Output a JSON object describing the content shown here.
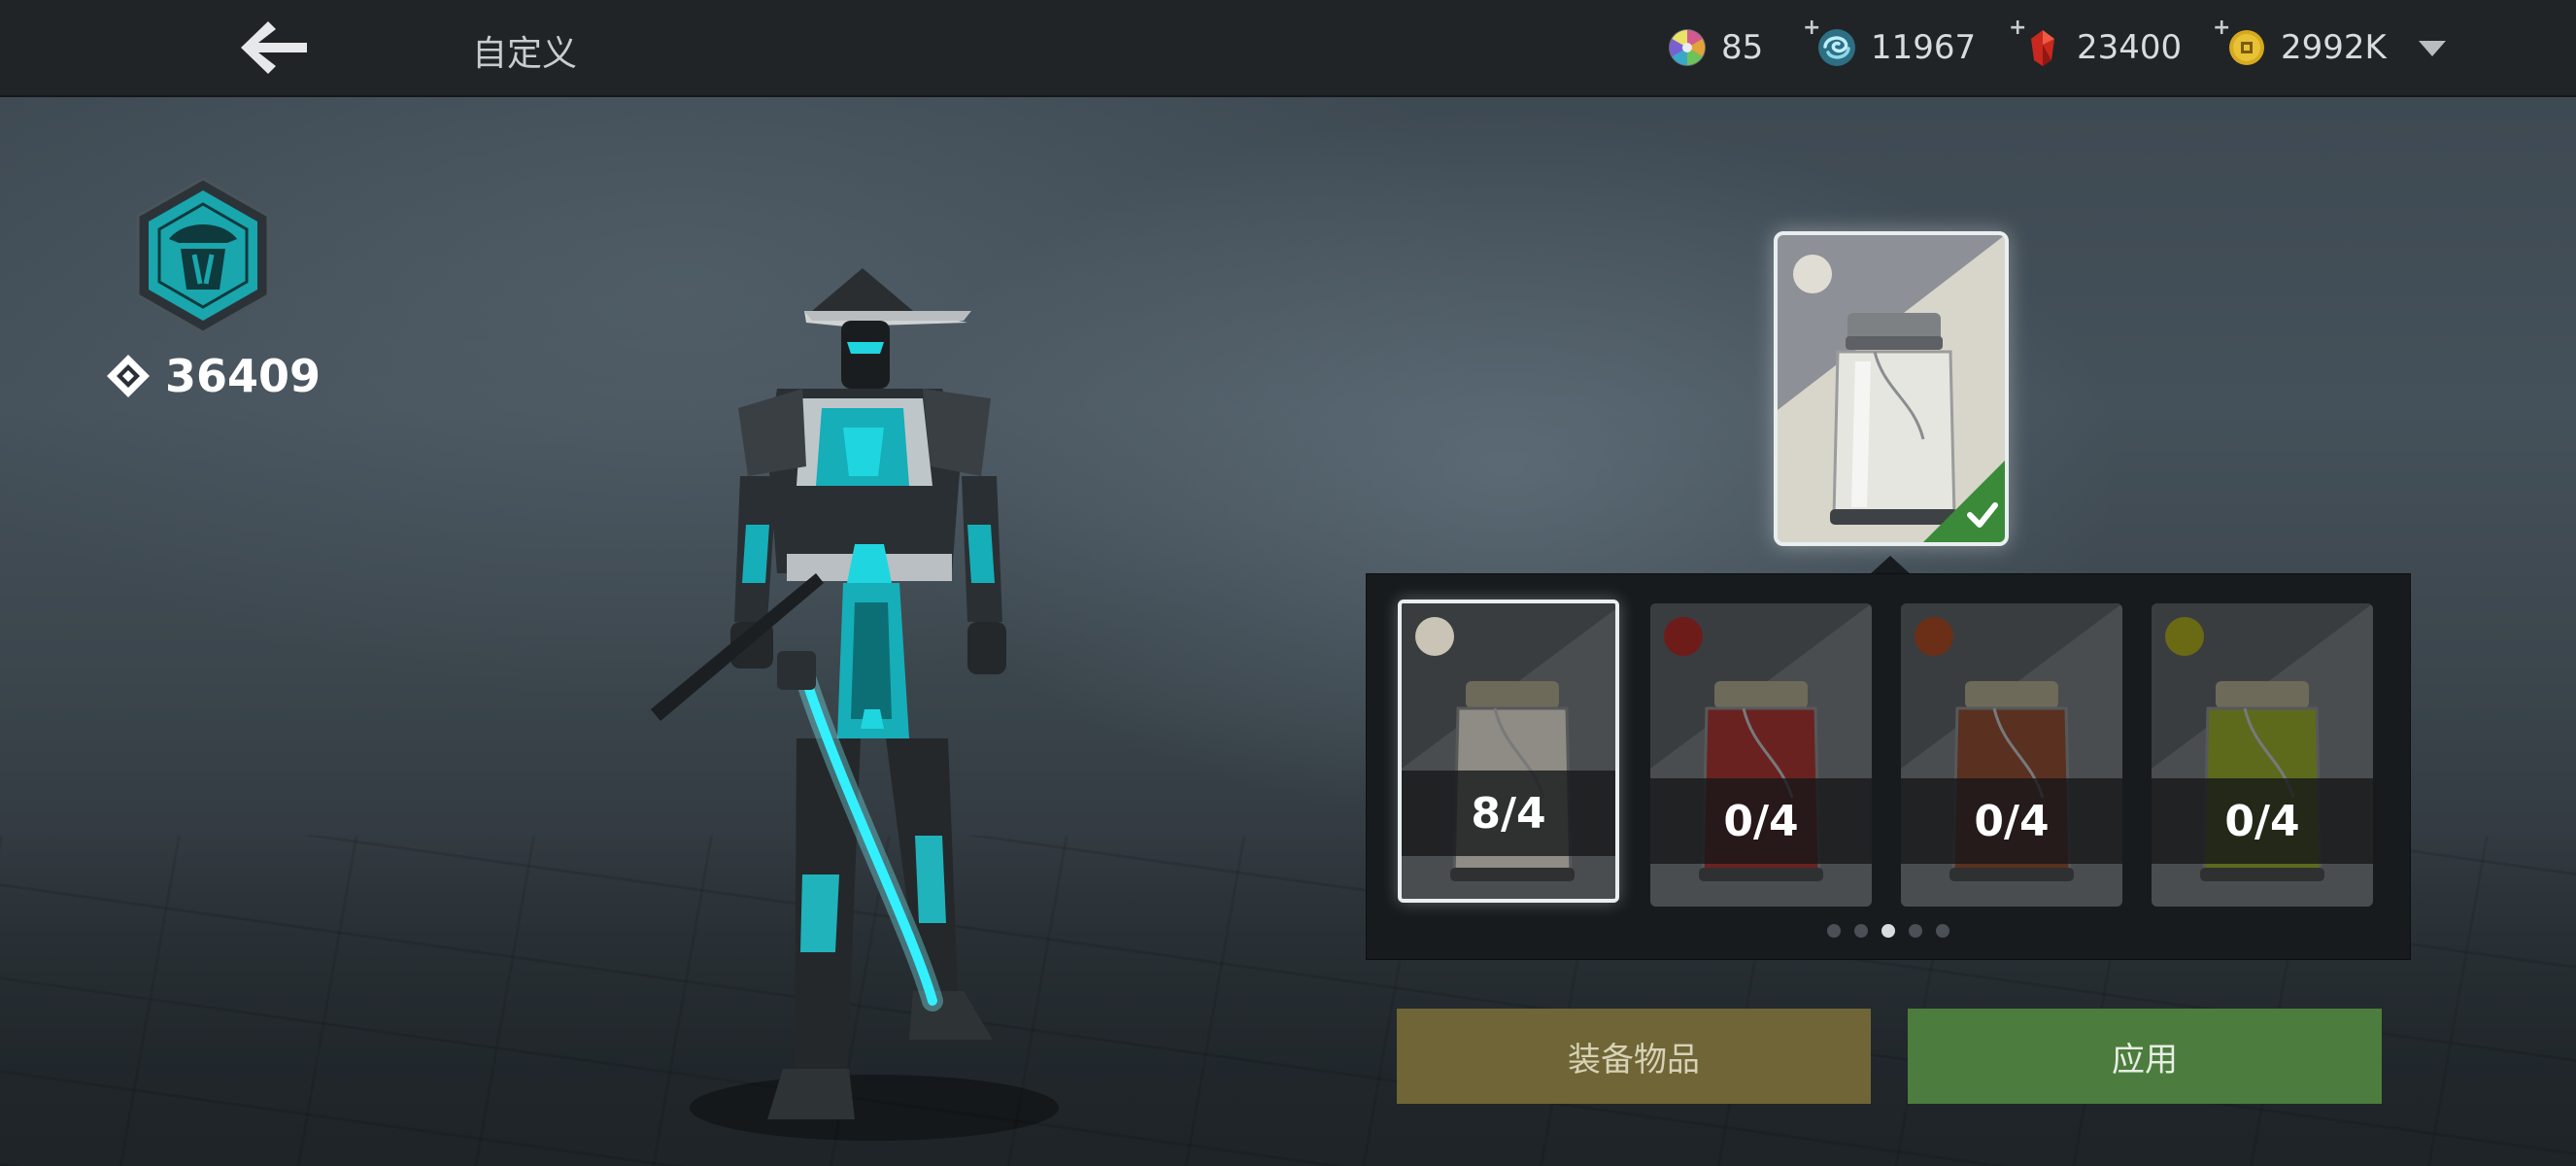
{
  "header": {
    "title": "自定义",
    "back_icon": "back-arrow-icon",
    "currencies": [
      {
        "id": "chroma",
        "icon": "color-wheel-icon",
        "value": "85",
        "has_plus": false
      },
      {
        "id": "energy",
        "icon": "swirl-orb-icon",
        "value": "11967",
        "has_plus": true
      },
      {
        "id": "gems",
        "icon": "red-gem-icon",
        "value": "23400",
        "has_plus": true
      },
      {
        "id": "coins",
        "icon": "gold-coin-icon",
        "value": "2992K",
        "has_plus": true
      }
    ],
    "menu_icon": "chevron-down-icon"
  },
  "player": {
    "emblem_icon": "clan-emblem-icon",
    "power_icon": "power-diamond-icon",
    "power_value": "36409"
  },
  "selected_item": {
    "icon": "glass-jar-icon",
    "equipped": true
  },
  "inventory": {
    "items": [
      {
        "count": "8/4",
        "color": "#c9c4b6",
        "tint": "#8e8c84",
        "active": true
      },
      {
        "count": "0/4",
        "color": "#6e1c1a",
        "tint": "#6a2220",
        "active": false
      },
      {
        "count": "0/4",
        "color": "#6a2f16",
        "tint": "#5a3020",
        "active": false
      },
      {
        "count": "0/4",
        "color": "#6b6a14",
        "tint": "#5d6a1c",
        "active": false
      }
    ],
    "page_count": 5,
    "current_page": 3
  },
  "actions": {
    "equip_label": "装备物品",
    "apply_label": "应用"
  },
  "colors": {
    "accent_teal": "#1fd6e0",
    "equip_button": "#6f6537",
    "apply_button": "#4c7d3e"
  }
}
